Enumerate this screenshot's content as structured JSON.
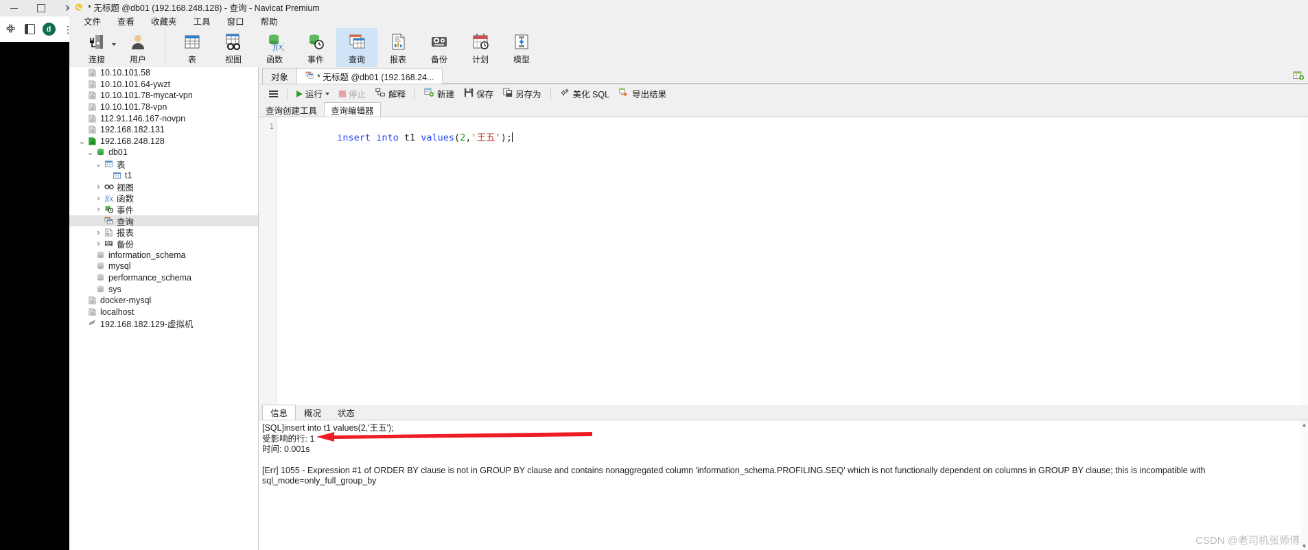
{
  "browser": {
    "minimize_label": "—",
    "maximize_label": "❐",
    "close_label": "✕",
    "profile_initial": "d",
    "kebab_label": "⋮"
  },
  "window": {
    "title": "* 无标题 @db01 (192.168.248.128) - 查询 - Navicat Premium"
  },
  "menu": {
    "items": [
      {
        "label": "文件"
      },
      {
        "label": "查看"
      },
      {
        "label": "收藏夹"
      },
      {
        "label": "工具"
      },
      {
        "label": "窗口"
      },
      {
        "label": "帮助"
      }
    ]
  },
  "ribbon": {
    "items": [
      {
        "label": "连接",
        "icon": "connection-icon",
        "active": false,
        "has_caret": true
      },
      {
        "label": "用户",
        "icon": "user-icon",
        "active": false,
        "has_caret": false
      },
      {
        "label": "表",
        "icon": "table-icon",
        "active": false,
        "has_caret": false
      },
      {
        "label": "视图",
        "icon": "view-icon",
        "active": false,
        "has_caret": false
      },
      {
        "label": "函数",
        "icon": "function-icon",
        "active": false,
        "has_caret": false
      },
      {
        "label": "事件",
        "icon": "event-icon",
        "active": false,
        "has_caret": false
      },
      {
        "label": "查询",
        "icon": "query-icon",
        "active": true,
        "has_caret": false
      },
      {
        "label": "报表",
        "icon": "report-icon",
        "active": false,
        "has_caret": false
      },
      {
        "label": "备份",
        "icon": "backup-icon",
        "active": false,
        "has_caret": false
      },
      {
        "label": "计划",
        "icon": "schedule-icon",
        "active": false,
        "has_caret": false
      },
      {
        "label": "模型",
        "icon": "model-icon",
        "active": false,
        "has_caret": false
      }
    ]
  },
  "sidebar": {
    "items": [
      {
        "label": "10.10.101.58",
        "indent": 0,
        "chevron": "",
        "icon": "connection-gray-icon",
        "selected": false
      },
      {
        "label": "10.10.101.64-ywzt",
        "indent": 0,
        "chevron": "",
        "icon": "connection-gray-icon",
        "selected": false
      },
      {
        "label": "10.10.101.78-mycat-vpn",
        "indent": 0,
        "chevron": "",
        "icon": "connection-gray-icon",
        "selected": false
      },
      {
        "label": "10.10.101.78-vpn",
        "indent": 0,
        "chevron": "",
        "icon": "connection-gray-icon",
        "selected": false
      },
      {
        "label": "112.91.146.167-novpn",
        "indent": 0,
        "chevron": "",
        "icon": "connection-gray-icon",
        "selected": false
      },
      {
        "label": "192.168.182.131",
        "indent": 0,
        "chevron": "",
        "icon": "connection-gray-icon",
        "selected": false
      },
      {
        "label": "192.168.248.128",
        "indent": 0,
        "chevron": "v",
        "icon": "connection-green-icon",
        "selected": false
      },
      {
        "label": "db01",
        "indent": 1,
        "chevron": "v",
        "icon": "database-green-icon",
        "selected": false
      },
      {
        "label": "表",
        "indent": 2,
        "chevron": "v",
        "icon": "table-blue-icon",
        "selected": false
      },
      {
        "label": "t1",
        "indent": 3,
        "chevron": "",
        "icon": "table-blue-icon",
        "selected": false
      },
      {
        "label": "视图",
        "indent": 2,
        "chevron": ">",
        "icon": "view-glasses-icon",
        "selected": false
      },
      {
        "label": "函数",
        "indent": 2,
        "chevron": ">",
        "icon": "function-fx-icon",
        "selected": false
      },
      {
        "label": "事件",
        "indent": 2,
        "chevron": ">",
        "icon": "event-clock-icon",
        "selected": false
      },
      {
        "label": "查询",
        "indent": 2,
        "chevron": "",
        "icon": "query-icon",
        "selected": true
      },
      {
        "label": "报表",
        "indent": 2,
        "chevron": ">",
        "icon": "report-icon",
        "selected": false
      },
      {
        "label": "备份",
        "indent": 2,
        "chevron": ">",
        "icon": "backup-icon",
        "selected": false
      },
      {
        "label": "information_schema",
        "indent": 1,
        "chevron": "",
        "icon": "database-gray-icon",
        "selected": false
      },
      {
        "label": "mysql",
        "indent": 1,
        "chevron": "",
        "icon": "database-gray-icon",
        "selected": false
      },
      {
        "label": "performance_schema",
        "indent": 1,
        "chevron": "",
        "icon": "database-gray-icon",
        "selected": false
      },
      {
        "label": "sys",
        "indent": 1,
        "chevron": "",
        "icon": "database-gray-icon",
        "selected": false
      },
      {
        "label": "docker-mysql",
        "indent": 0,
        "chevron": "",
        "icon": "connection-gray-icon",
        "selected": false
      },
      {
        "label": "localhost",
        "indent": 0,
        "chevron": "",
        "icon": "connection-gray-icon",
        "selected": false
      },
      {
        "label": "192.168.182.129-虚拟机",
        "indent": 0,
        "chevron": "",
        "icon": "mariadb-icon",
        "selected": false
      }
    ]
  },
  "object_tabs": {
    "tabs": [
      {
        "label": "对象",
        "active": false,
        "has_icon": false
      },
      {
        "label": "* 无标题 @db01 (192.168.24...",
        "active": true,
        "has_icon": true
      }
    ],
    "right_icon": "new-tab-icon"
  },
  "query_toolbar": {
    "menu_icon": "hamburger-icon",
    "buttons": [
      {
        "label": "运行",
        "icon": "play-icon",
        "disabled": false,
        "caret": true
      },
      {
        "label": "停止",
        "icon": "stop-icon",
        "disabled": true,
        "caret": false
      },
      {
        "label": "解释",
        "icon": "explain-icon",
        "disabled": false,
        "caret": false
      },
      {
        "label": "新建",
        "icon": "new-icon",
        "disabled": false,
        "caret": false
      },
      {
        "label": "保存",
        "icon": "save-icon",
        "disabled": false,
        "caret": false
      },
      {
        "label": "另存为",
        "icon": "save-as-icon",
        "disabled": false,
        "caret": false
      },
      {
        "label": "美化 SQL",
        "icon": "beautify-icon",
        "disabled": false,
        "caret": false
      },
      {
        "label": "导出结果",
        "icon": "export-icon",
        "disabled": false,
        "caret": false
      }
    ]
  },
  "editor_tabs": {
    "tabs": [
      {
        "label": "查询创建工具",
        "active": false
      },
      {
        "label": "查询编辑器",
        "active": true
      }
    ]
  },
  "editor": {
    "line_number": "1",
    "sql_full": "insert into t1 values(2,'王五');",
    "tokens": [
      {
        "text": "insert",
        "type": "kw"
      },
      {
        "text": " ",
        "type": "punct"
      },
      {
        "text": "into",
        "type": "kw"
      },
      {
        "text": " ",
        "type": "punct"
      },
      {
        "text": "t1",
        "type": "ident"
      },
      {
        "text": " ",
        "type": "punct"
      },
      {
        "text": "values",
        "type": "kw"
      },
      {
        "text": "(",
        "type": "punct"
      },
      {
        "text": "2",
        "type": "num"
      },
      {
        "text": ",",
        "type": "punct"
      },
      {
        "text": "'王五'",
        "type": "str"
      },
      {
        "text": ")",
        "type": "punct"
      },
      {
        "text": ";",
        "type": "punct"
      }
    ]
  },
  "result_tabs": {
    "tabs": [
      {
        "label": "信息",
        "active": true
      },
      {
        "label": "概况",
        "active": false
      },
      {
        "label": "状态",
        "active": false
      }
    ]
  },
  "messages": {
    "line1": "[SQL]insert into t1 values(2,'王五');",
    "line2": "受影响的行: 1",
    "line3": "时间: 0.001s",
    "error": "[Err] 1055 - Expression #1 of ORDER BY clause is not in GROUP BY clause and contains nonaggregated column 'information_schema.PROFILING.SEQ' which is not functionally dependent on columns in GROUP BY clause; this is incompatible with sql_mode=only_full_group_by"
  },
  "annotation": {
    "arrow_color": "#ee1c25",
    "arrow_name": "red-pointer-arrow"
  },
  "watermark": {
    "text": "CSDN @老司机张师傅"
  }
}
